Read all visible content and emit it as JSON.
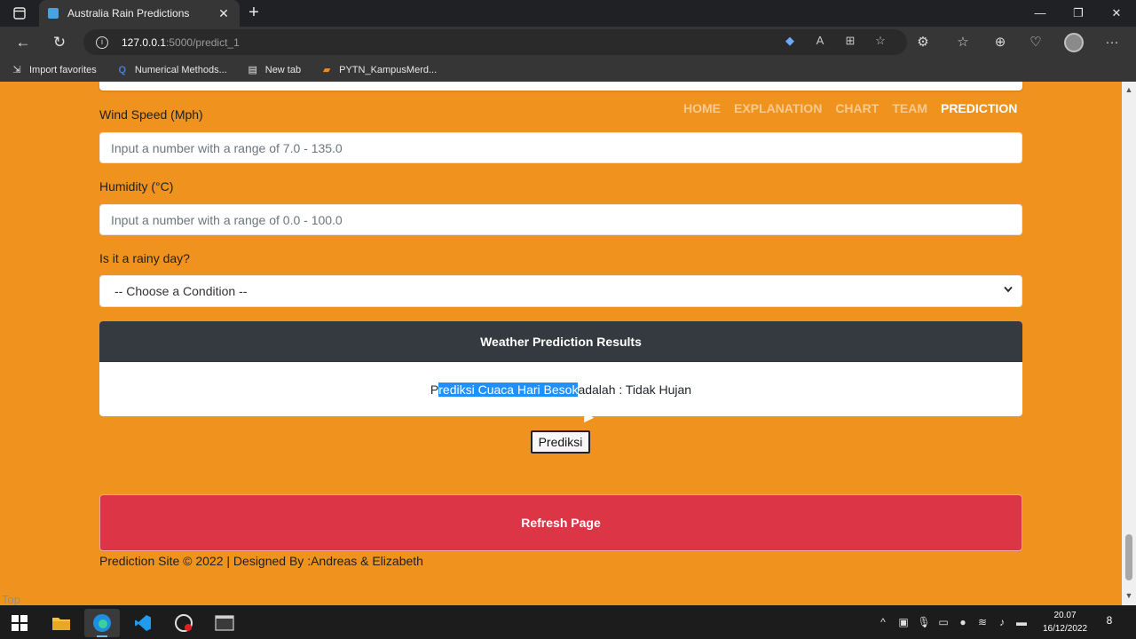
{
  "browser": {
    "tab_title": "Australia Rain Predictions",
    "url_host": "127.0.0.1",
    "url_path": ":5000/predict_1",
    "favorites": [
      {
        "icon": "import-icon",
        "label": "Import favorites"
      },
      {
        "icon": "q-icon",
        "label": "Numerical Methods..."
      },
      {
        "icon": "newtab-icon",
        "label": "New tab"
      },
      {
        "icon": "kampus-icon",
        "label": "PYTN_KampusMerd..."
      }
    ]
  },
  "nav": {
    "links": [
      "HOME",
      "EXPLANATION",
      "CHART",
      "TEAM",
      "PREDICTION"
    ],
    "active": "PREDICTION"
  },
  "form": {
    "wind_label": "Wind Speed (Mph)",
    "wind_placeholder": "Input a number with a range of 7.0 - 135.0",
    "humidity_label": "Humidity (°C)",
    "humidity_placeholder": "Input a number with a range of 0.0 - 100.0",
    "rainy_label": "Is it a rainy day?",
    "rainy_selected": "-- Choose a Condition --"
  },
  "results": {
    "header": "Weather Prediction Results",
    "text_prefix": "P",
    "text_selected": "rediksi Cuaca Hari Besok",
    "text_suffix": " adalah : Tidak Hujan"
  },
  "buttons": {
    "predict": "Prediksi",
    "refresh": "Refresh Page"
  },
  "footer": {
    "text": "Prediction Site © 2022 | Designed By :Andreas & Elizabeth",
    "top_link": "Top"
  },
  "taskbar": {
    "time": "20.07",
    "date": "16/12/2022",
    "notification_count": "8"
  },
  "colors": {
    "page_bg": "#f0931e",
    "result_header": "#343a40",
    "refresh_bg": "#dc3545"
  }
}
